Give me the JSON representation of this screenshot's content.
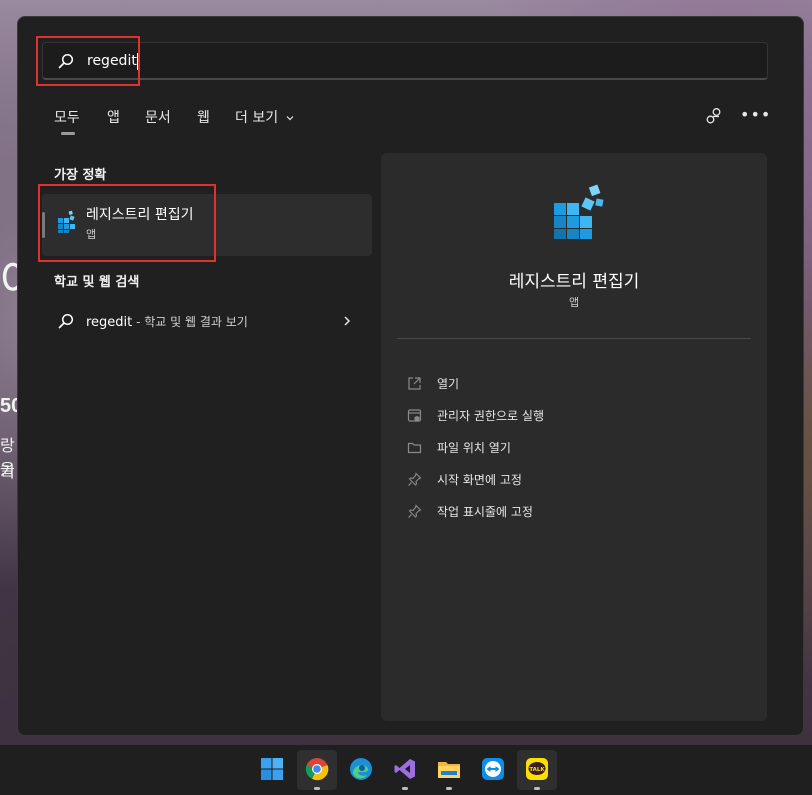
{
  "wallpaper": {
    "left_text_1": "어",
    "left_text_2": "50",
    "left_text_3": "랑을",
    "left_text_4": "기"
  },
  "search": {
    "value": "regedit",
    "icon": "search-icon"
  },
  "tabs": [
    {
      "label": "모두",
      "selected": true
    },
    {
      "label": "앱"
    },
    {
      "label": "문서"
    },
    {
      "label": "웹"
    },
    {
      "label": "더 보기"
    }
  ],
  "header_icons": {
    "share": "share-icon",
    "more": "ellipsis-icon",
    "ellipsis_text": "•••"
  },
  "best_match": {
    "heading": "가장 정확",
    "title": "레지스트리 편집기",
    "subtitle": "앱"
  },
  "web_search": {
    "heading": "학교 및 웹 검색",
    "query": "regedit",
    "suffix": " - 학교 및 웹 결과 보기"
  },
  "detail": {
    "title": "레지스트리 편집기",
    "subtitle": "앱",
    "actions": [
      {
        "label": "열기",
        "icon": "open-external-icon"
      },
      {
        "label": "관리자 권한으로 실행",
        "icon": "admin-shield-icon"
      },
      {
        "label": "파일 위치 열기",
        "icon": "folder-icon"
      },
      {
        "label": "시작 화면에 고정",
        "icon": "pin-icon"
      },
      {
        "label": "작업 표시줄에 고정",
        "icon": "pin-icon"
      }
    ]
  },
  "taskbar": {
    "apps": [
      {
        "name": "windows-start-icon"
      },
      {
        "name": "chrome-icon",
        "running": true
      },
      {
        "name": "edge-icon"
      },
      {
        "name": "visual-studio-icon",
        "running": true
      },
      {
        "name": "file-explorer-icon",
        "running": true
      },
      {
        "name": "teamviewer-icon"
      },
      {
        "name": "kakaotalk-icon",
        "running": true,
        "label": "TALK"
      }
    ]
  },
  "colors": {
    "highlight_red": "#e0312e",
    "panel_bg": "#202020",
    "pane_bg": "#2b2b2b",
    "regedit_blue": "#1e9be0"
  }
}
